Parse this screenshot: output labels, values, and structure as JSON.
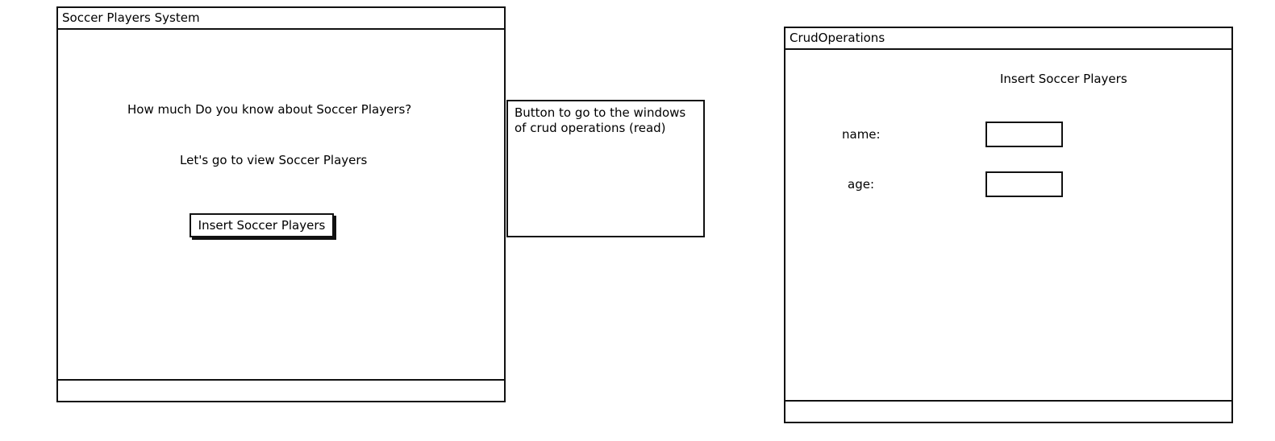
{
  "main_window": {
    "title": "Soccer Players System",
    "question": "How much Do you know about Soccer Players?",
    "subtitle": "Let's go to view Soccer Players",
    "insert_button_label": "Insert Soccer Players"
  },
  "annotation": {
    "text": "Button to go to the windows of crud operations (read)"
  },
  "crud_window": {
    "title": "CrudOperations",
    "heading": "Insert Soccer Players",
    "fields": [
      {
        "label": "name:",
        "value": ""
      },
      {
        "label": "age:",
        "value": ""
      }
    ]
  }
}
